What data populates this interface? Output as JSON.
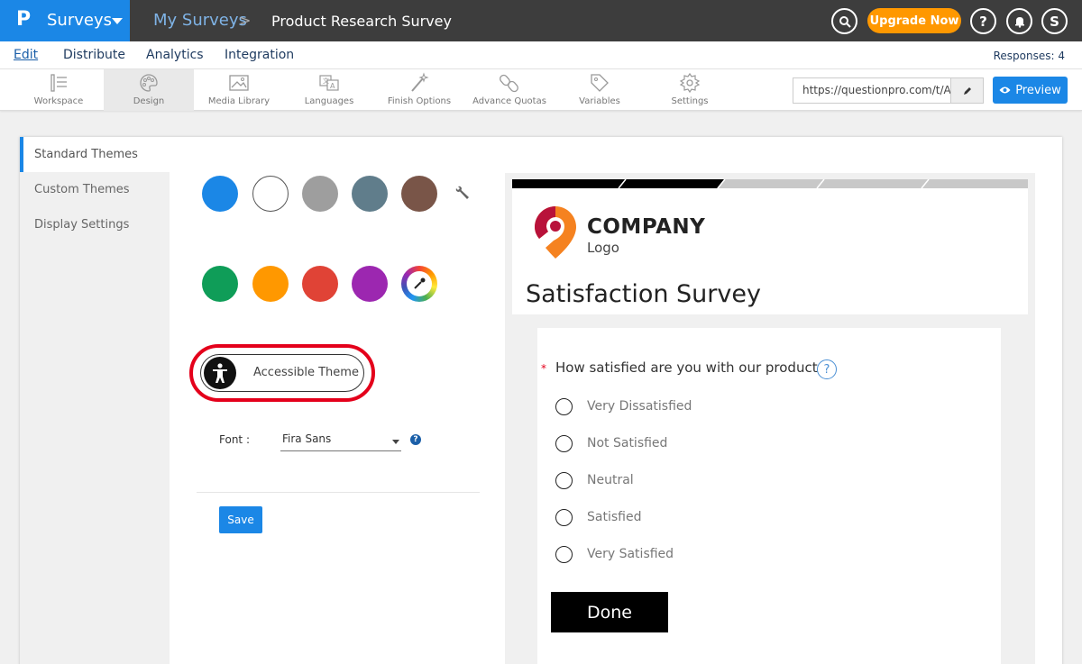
{
  "topbar": {
    "logo": "P",
    "app_name": "Surveys",
    "breadcrumb_root": "My Surveys",
    "breadcrumb_sep": ">",
    "breadcrumb_current": "Product Research Survey",
    "upgrade_label": "Upgrade Now",
    "help_label": "?",
    "avatar_initial": "S"
  },
  "nav": {
    "items": [
      "Edit",
      "Distribute",
      "Analytics",
      "Integration"
    ],
    "responses": "Responses: 4"
  },
  "toolbar": {
    "tools": [
      {
        "label": "Workspace",
        "icon": "workspace-icon"
      },
      {
        "label": "Design",
        "icon": "palette-icon"
      },
      {
        "label": "Media Library",
        "icon": "image-icon"
      },
      {
        "label": "Languages",
        "icon": "translate-icon"
      },
      {
        "label": "Finish Options",
        "icon": "wand-icon"
      },
      {
        "label": "Advance Quotas",
        "icon": "link-icon"
      },
      {
        "label": "Variables",
        "icon": "tag-icon"
      },
      {
        "label": "Settings",
        "icon": "gear-icon"
      }
    ],
    "url": "https://questionpro.com/t/AV",
    "preview_label": "Preview"
  },
  "sidebar": {
    "items": [
      "Standard Themes",
      "Custom Themes",
      "Display Settings"
    ]
  },
  "themes": {
    "colors_row1": [
      "#1b87e6",
      "#ffffff",
      "#9e9e9e",
      "#607d8b",
      "#795548"
    ],
    "colors_row2": [
      "#0f9d58",
      "#ff9800",
      "#e04336",
      "#9c27b0"
    ],
    "accessible_label": "Accessible Theme",
    "font_label": "Font :",
    "font_value": "Fira Sans",
    "font_help": "?",
    "save_label": "Save"
  },
  "preview": {
    "company": "COMPANY",
    "logo_sub": "Logo",
    "title": "Satisfaction Survey",
    "required_mark": "*",
    "question": "How satisfied are you with our product",
    "question_help": "?",
    "options": [
      "Very Dissatisfied",
      "Not Satisfied",
      "Neutral",
      "Satisfied",
      "Very Satisfied"
    ],
    "done_label": "Done"
  }
}
